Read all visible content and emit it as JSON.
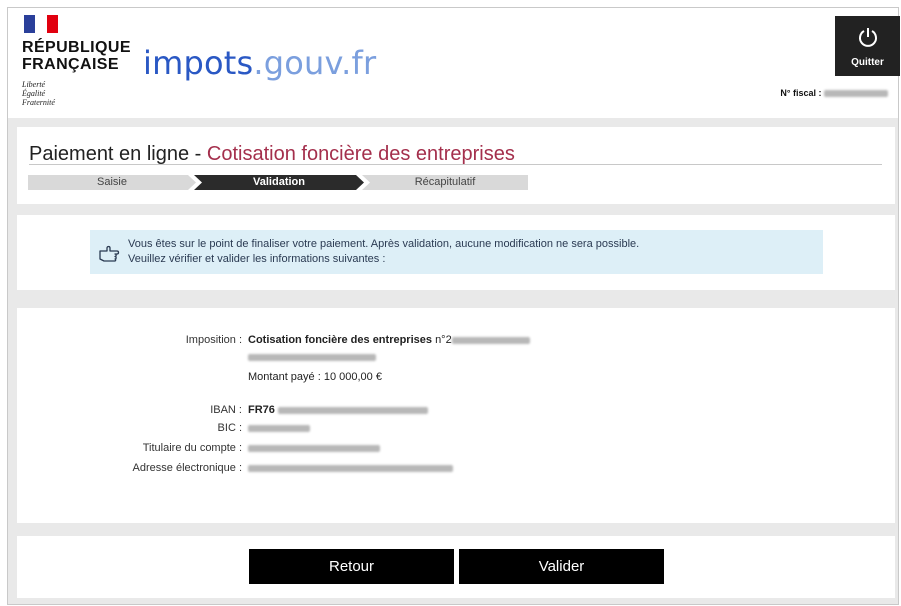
{
  "header": {
    "republic_line1": "RÉPUBLIQUE",
    "republic_line2": "FRANÇAISE",
    "motto_1": "Liberté",
    "motto_2": "Égalité",
    "motto_3": "Fraternité",
    "logo_main": "impots",
    "logo_tld": ".gouv.fr",
    "quit_label": "Quitter",
    "fiscal_label": "N° fiscal :"
  },
  "page": {
    "title_prefix": "Paiement en ligne - ",
    "title_accent": "Cotisation foncière des entreprises"
  },
  "steps": [
    "Saisie",
    "Validation",
    "Récapitulatif"
  ],
  "notice": {
    "line1": "Vous êtes sur le point de finaliser votre paiement. Après validation, aucune modification ne sera possible.",
    "line2": "Veuillez vérifier et valider les informations suivantes :"
  },
  "details": {
    "imposition_label": "Imposition :",
    "imposition_value": "Cotisation foncière des entreprises",
    "imposition_num_prefix": "n°2",
    "amount_text": "Montant payé : 10 000,00 €",
    "iban_label": "IBAN :",
    "iban_prefix": "FR76",
    "bic_label": "BIC :",
    "holder_label": "Titulaire du compte :",
    "email_label": "Adresse électronique :"
  },
  "actions": {
    "back_label": "Retour",
    "submit_label": "Valider"
  },
  "colors": {
    "accent": "#a42f4c",
    "logo_blue": "#2a58c4",
    "notice_bg": "#ddeff7"
  }
}
